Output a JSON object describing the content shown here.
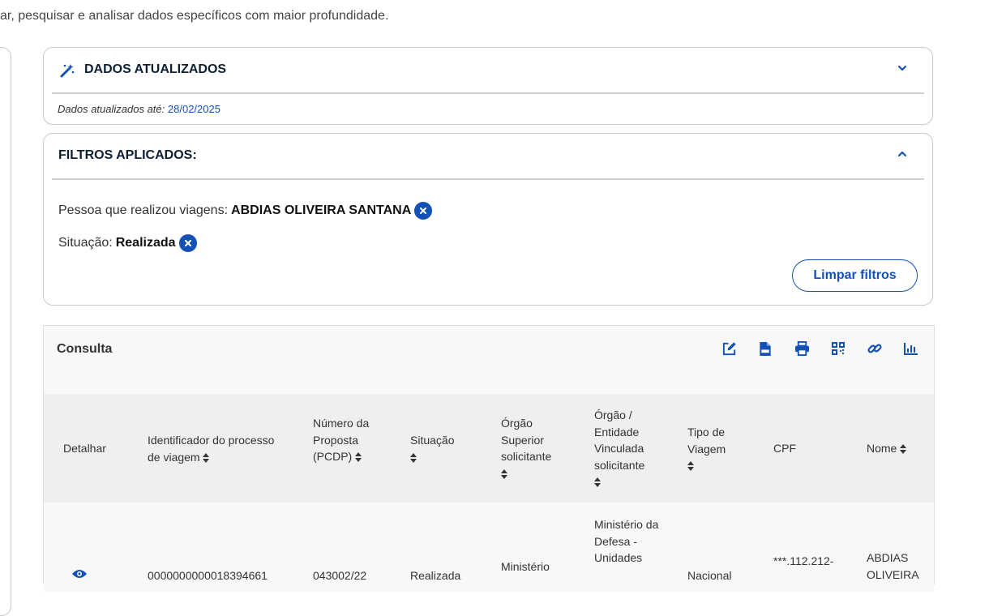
{
  "intro_text": "ar, pesquisar e analisar dados específicos com maior profundidade.",
  "updated": {
    "title": "DADOS ATUALIZADOS",
    "label": "Dados atualizados até:",
    "date": "28/02/2025"
  },
  "filters": {
    "title": "FILTROS APLICADOS:",
    "items": [
      {
        "label": "Pessoa que realizou viagens:",
        "value": "ABDIAS OLIVEIRA SANTANA"
      },
      {
        "label": "Situação:",
        "value": "Realizada"
      }
    ],
    "clear_label": "Limpar filtros"
  },
  "consulta": {
    "title": "Consulta",
    "tools": [
      "edit-icon",
      "csv-file-icon",
      "print-icon",
      "qr-code-icon",
      "link-icon",
      "chart-icon"
    ],
    "columns": [
      {
        "label": "Detalhar",
        "sortable": false
      },
      {
        "label": "Identificador do processo de viagem",
        "sortable": true
      },
      {
        "label": "Número da Proposta (PCDP)",
        "sortable": true
      },
      {
        "label": "Situação",
        "sortable": true
      },
      {
        "label": "Órgão Superior solicitante",
        "sortable": true
      },
      {
        "label": "Órgão / Entidade Vinculada solicitante",
        "sortable": true
      },
      {
        "label": "Tipo de Viagem",
        "sortable": true
      },
      {
        "label": "CPF",
        "sortable": false
      },
      {
        "label": "Nome",
        "sortable": true
      }
    ],
    "rows": [
      {
        "identificador": "0000000000018394661",
        "pcdp": "043002/22",
        "situacao": "Realizada",
        "orgao_superior": "Ministério",
        "orgao_entidade": "Ministério da Defesa - Unidades",
        "tipo": "Nacional",
        "cpf": "***.112.212-",
        "nome": "ABDIAS OLIVEIRA"
      }
    ]
  },
  "colors": {
    "primary": "#1351b4",
    "dark_title": "#0c1f33"
  }
}
